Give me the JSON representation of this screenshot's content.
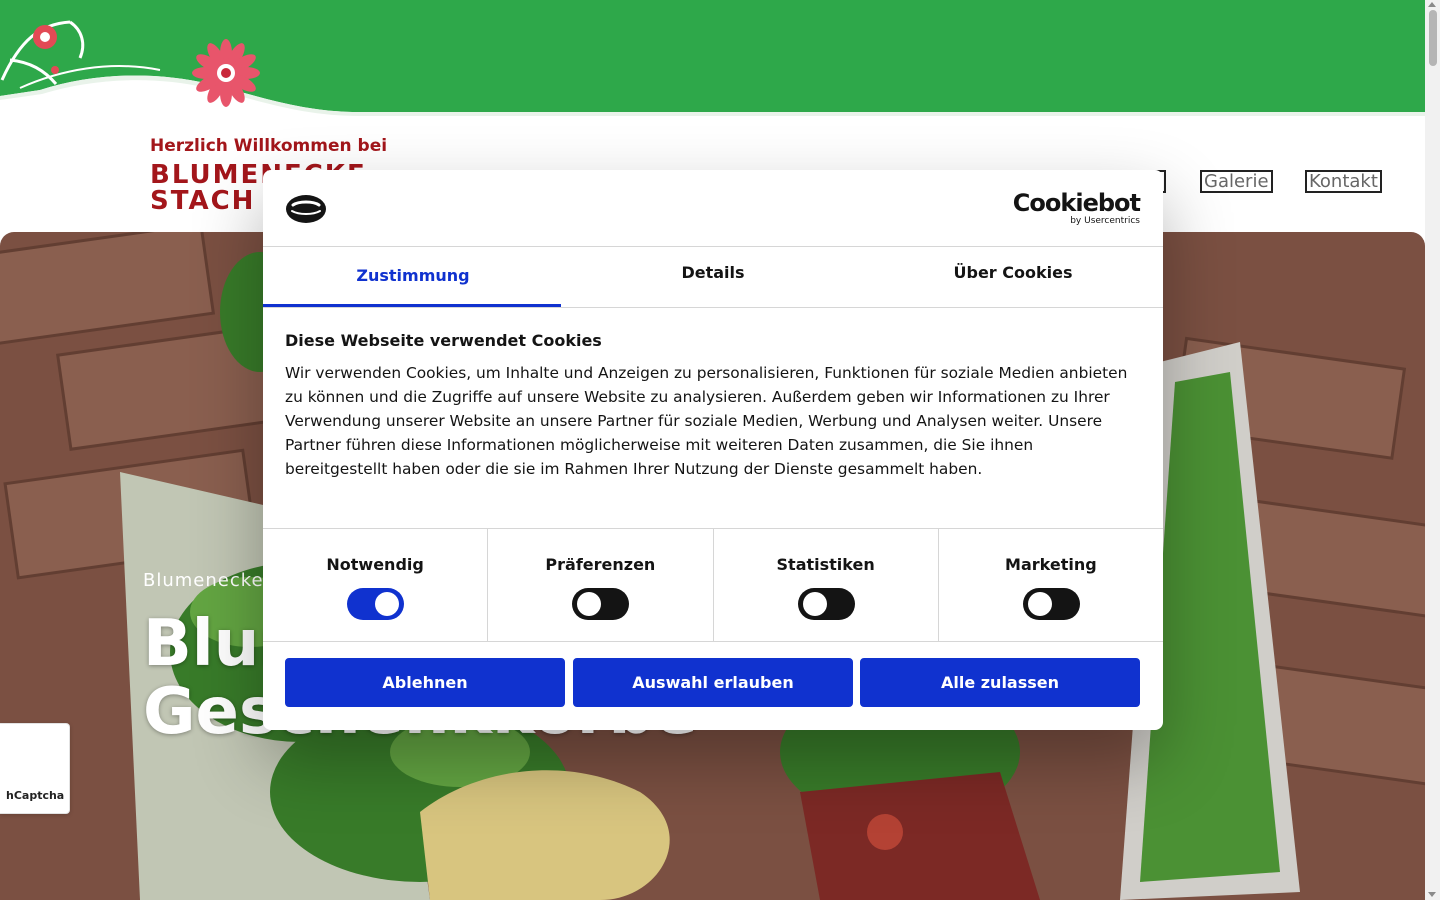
{
  "header": {
    "welcome": "Herzlich Willkommen bei",
    "brand_line1": "BLUMENECKE",
    "brand_line2": "STACH",
    "nav": [
      {
        "label": "Galerie"
      },
      {
        "label": "Kontakt"
      }
    ],
    "band_color": "#2ea84a"
  },
  "hero": {
    "kicker": "Blumenecke",
    "title_line1": "Blumen",
    "title_line2": "Geschenkkörbe"
  },
  "cookie_dialog": {
    "brand_name": "Cookiebot",
    "brand_sub": "by Usercentrics",
    "tabs": [
      {
        "label": "Zustimmung",
        "active": true
      },
      {
        "label": "Details",
        "active": false
      },
      {
        "label": "Über Cookies",
        "active": false
      }
    ],
    "heading": "Diese Webseite verwendet Cookies",
    "text": "Wir verwenden Cookies, um Inhalte und Anzeigen zu personalisieren, Funktionen für soziale Medien anbieten zu können und die Zugriffe auf unsere Website zu analysieren. Außerdem geben wir Informationen zu Ihrer Verwendung unserer Website an unsere Partner für soziale Medien, Werbung und Analysen weiter. Unsere Partner führen diese Informationen möglicherweise mit weiteren Daten zusammen, die Sie ihnen bereitgestellt haben oder die sie im Rahmen Ihrer Nutzung der Dienste gesammelt haben.",
    "categories": [
      {
        "label": "Notwendig",
        "enabled": true
      },
      {
        "label": "Präferenzen",
        "enabled": false
      },
      {
        "label": "Statistiken",
        "enabled": false
      },
      {
        "label": "Marketing",
        "enabled": false
      }
    ],
    "buttons": {
      "decline": "Ablehnen",
      "allow_selection": "Auswahl erlauben",
      "allow_all": "Alle zulassen"
    },
    "accent_color": "#1032cf"
  },
  "captcha": {
    "label": "hCaptcha"
  }
}
